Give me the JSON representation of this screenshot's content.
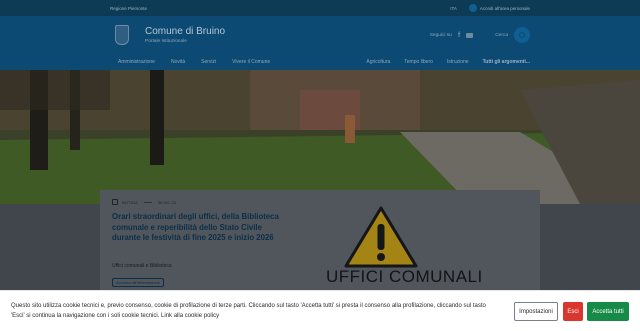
{
  "slimbar": {
    "region": "Regione Piemonte",
    "lang": "ITA",
    "login": "Accedi all'area personale"
  },
  "header": {
    "title": "Comune di Bruino",
    "subtitle": "Portale Istituzionale",
    "follow": "Seguici su",
    "search": "Cerca"
  },
  "nav": {
    "main": [
      "Amministrazione",
      "Novità",
      "Servizi",
      "Vivere il Comune"
    ],
    "secondary": [
      "Agricoltura",
      "Tempo libero",
      "Istruzione"
    ],
    "all_topics": "Tutti gli argomenti..."
  },
  "news": {
    "type": "NOTIZIA",
    "date": "30 DIC 24",
    "title": "Orari straordinari degli uffici, della Biblioteca comunale e reperibilità dello Stato Civile durante le festività di fine 2025 e inizio 2026",
    "office": "Uffici comunali e Biblioteca",
    "tag": "Accesso all'informazione",
    "image_text": "UFFICI COMUNALI"
  },
  "cookie": {
    "text": "Questo sito utilizza cookie tecnici e, previo consenso, cookie di profilazione di terze parti. Cliccando sul tasto 'Accetta tutti' si presta il consenso alla profilazione, cliccando sul tasto 'Esci' si continua la navigazione con i soli cookie tecnici. Link alla cookie policy",
    "settings": "Impostazioni",
    "exit": "Esci",
    "accept": "Accetta tutti"
  },
  "colors": {
    "primary": "#0c4a74",
    "accept": "#168a47",
    "exit": "#d9362d"
  }
}
